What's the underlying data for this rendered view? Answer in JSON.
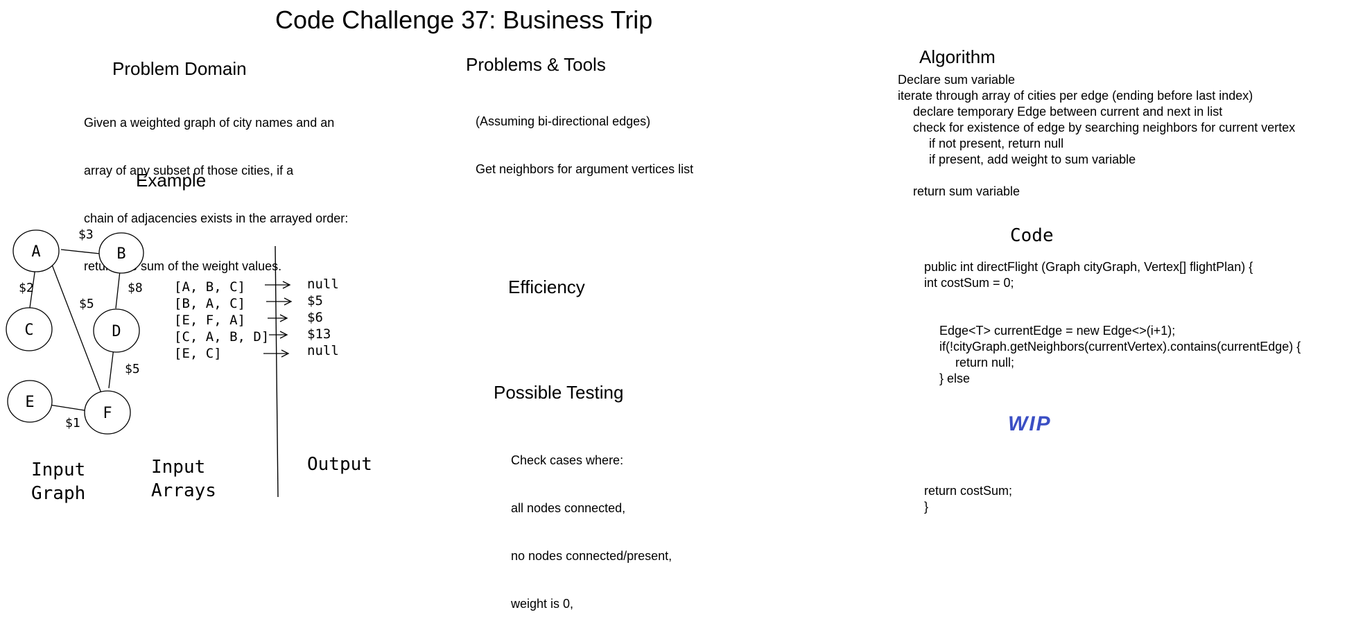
{
  "title": "Code Challenge 37: Business Trip",
  "problem_domain": {
    "heading": "Problem Domain",
    "lines": [
      "Given a weighted graph of city names and an",
      "array of any subset of those cities, if a",
      "chain of adjacencies exists in the arrayed order:",
      "return the sum of the weight values."
    ]
  },
  "example": {
    "heading": "Example"
  },
  "graph": {
    "nodes": [
      {
        "label": "A"
      },
      {
        "label": "B"
      },
      {
        "label": "C"
      },
      {
        "label": "D"
      },
      {
        "label": "E"
      },
      {
        "label": "F"
      }
    ],
    "weights": [
      "$3",
      "$2",
      "$8",
      "$5",
      "$5",
      "$1"
    ]
  },
  "input_arrays": [
    "[A, B, C]",
    "[B, A, C]",
    "[E, F, A]",
    "[C, A, B, D]",
    "[E, C]"
  ],
  "outputs": [
    "null",
    "$5",
    "$6",
    "$13",
    "null"
  ],
  "captions": {
    "input_graph_1": "Input",
    "input_graph_2": "Graph",
    "input_arrays_1": "Input",
    "input_arrays_2": "Arrays",
    "output": "Output"
  },
  "problems_tools": {
    "heading": "Problems & Tools",
    "lines": [
      "(Assuming bi-directional edges)",
      "Get neighbors for argument vertices list"
    ]
  },
  "efficiency": {
    "heading": "Efficiency"
  },
  "testing": {
    "heading": "Possible Testing",
    "lines": [
      "Check cases where:",
      "all nodes connected,",
      "no nodes connected/present,",
      "weight is 0,"
    ]
  },
  "algorithm": {
    "heading": "Algorithm",
    "lines": [
      "Declare sum variable",
      "iterate through array of cities per edge (ending before last index)",
      "declare temporary Edge between current and next in list",
      "check for existence of edge by searching neighbors for current vertex",
      "if not present, return null",
      "if present, add weight to sum variable",
      "return sum variable"
    ]
  },
  "code": {
    "heading": "Code",
    "lines": [
      "public int directFlight (Graph cityGraph, Vertex[] flightPlan) {",
      "int costSum = 0;",
      "Edge<T> currentEdge = new Edge<>(i+1);",
      "if(!cityGraph.getNeighbors(currentVertex).contains(currentEdge) {",
      "return null;",
      "} else",
      "return costSum;",
      "}"
    ],
    "wip": "WIP"
  }
}
